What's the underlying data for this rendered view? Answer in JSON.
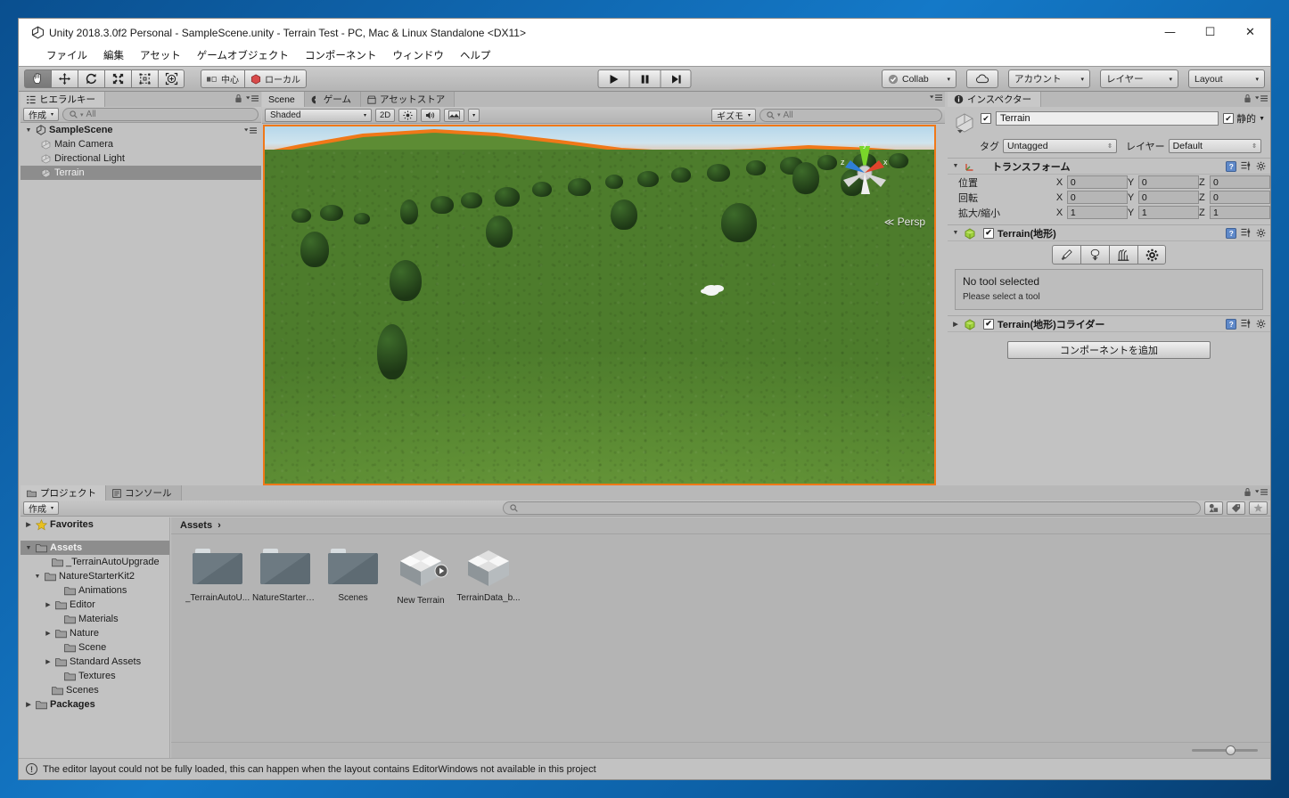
{
  "window": {
    "title": "Unity 2018.3.0f2 Personal - SampleScene.unity - Terrain Test - PC, Mac & Linux Standalone <DX11>",
    "minimize": "—",
    "maximize": "☐",
    "close": "✕"
  },
  "menu": {
    "items": [
      {
        "label": "ファイル"
      },
      {
        "label": "編集"
      },
      {
        "label": "アセット"
      },
      {
        "label": "ゲームオブジェクト"
      },
      {
        "label": "コンポーネント"
      },
      {
        "label": "ウィンドウ"
      },
      {
        "label": "ヘルプ"
      }
    ]
  },
  "toolbar": {
    "tools": [
      {
        "name": "hand-tool",
        "active": true
      },
      {
        "name": "move-tool",
        "active": false
      },
      {
        "name": "rotate-tool",
        "active": false
      },
      {
        "name": "scale-tool",
        "active": false
      },
      {
        "name": "rect-tool",
        "active": false
      },
      {
        "name": "transform-tool",
        "active": false
      }
    ],
    "pivot_label": "中心",
    "space_label": "ローカル",
    "play_label": "▶",
    "pause_label": "▐▐",
    "step_label": "▶|",
    "collab_label": "Collab",
    "cloud_label": "cloud-icon",
    "account_label": "アカウント",
    "layers_label": "レイヤー",
    "layout_label": "Layout",
    "caret": "▾"
  },
  "hierarchy": {
    "tab_label": "ヒエラルキー",
    "create_label": "作成",
    "search_placeholder": "All",
    "scene_name": "SampleScene",
    "items": [
      {
        "label": "Main Camera",
        "selected": false
      },
      {
        "label": "Directional Light",
        "selected": false
      },
      {
        "label": "Terrain",
        "selected": true
      }
    ]
  },
  "scene": {
    "tabs": [
      {
        "label": "Scene",
        "active": true
      },
      {
        "label": "ゲーム",
        "active": false
      },
      {
        "label": "アセットストア",
        "active": false
      }
    ],
    "shading_mode": "Shaded",
    "mode_2d": "2D",
    "lighting_icon": "sun-icon",
    "audio_icon": "speaker-icon",
    "effects_icon": "image-icon",
    "gizmos_label": "ギズモ",
    "search_placeholder": "All",
    "perspective_label": "Persp",
    "gizmo_axis_x": "x",
    "gizmo_axis_y": "y",
    "gizmo_axis_z": "z"
  },
  "inspector": {
    "tab_label": "インスペクター",
    "object_name": "Terrain",
    "object_enabled": true,
    "static_label": "静的",
    "static_checked": true,
    "tag_label": "タグ",
    "tag_value": "Untagged",
    "layer_label": "レイヤー",
    "layer_value": "Default",
    "transform": {
      "title": "トランスフォーム",
      "rows": [
        {
          "label": "位置",
          "x": "0",
          "y": "0",
          "z": "0"
        },
        {
          "label": "回転",
          "x": "0",
          "y": "0",
          "z": "0"
        },
        {
          "label": "拡大/縮小",
          "x": "1",
          "y": "1",
          "z": "1"
        }
      ],
      "axis_x": "X",
      "axis_y": "Y",
      "axis_z": "Z"
    },
    "terrain_component": {
      "title": "Terrain(地形)",
      "enabled": true,
      "tools": [
        {
          "name": "paint-brush-icon"
        },
        {
          "name": "paint-trees-icon"
        },
        {
          "name": "paint-details-icon"
        },
        {
          "name": "terrain-settings-icon"
        }
      ],
      "notice_title": "No tool selected",
      "notice_sub": "Please select a tool"
    },
    "collider_component": {
      "title": "Terrain(地形)コライダー",
      "enabled": true
    },
    "add_component_label": "コンポーネントを追加"
  },
  "project": {
    "tabs": [
      {
        "label": "プロジェクト",
        "active": true
      },
      {
        "label": "コンソール",
        "active": false
      }
    ],
    "create_label": "作成",
    "search_placeholder": "",
    "breadcrumb": "Assets",
    "breadcrumb_sep": "›",
    "tree": [
      {
        "label": "Favorites",
        "depth": 0,
        "arrow": "▶",
        "icon": "star-icon",
        "bold": true,
        "selected": false
      },
      {
        "label": "Assets",
        "depth": 0,
        "arrow": "▼",
        "icon": "folder-icon",
        "bold": true,
        "selected": true
      },
      {
        "label": "_TerrainAutoUpgrade",
        "depth": 1,
        "arrow": "",
        "icon": "folder-icon",
        "bold": false,
        "selected": false
      },
      {
        "label": "NatureStarterKit2",
        "depth": 1,
        "arrow": "▼",
        "icon": "folder-icon",
        "bold": false,
        "selected": false
      },
      {
        "label": "Animations",
        "depth": 2,
        "arrow": "",
        "icon": "folder-icon",
        "bold": false,
        "selected": false
      },
      {
        "label": "Editor",
        "depth": 2,
        "arrow": "▶",
        "icon": "folder-icon",
        "bold": false,
        "selected": false
      },
      {
        "label": "Materials",
        "depth": 2,
        "arrow": "",
        "icon": "folder-icon",
        "bold": false,
        "selected": false
      },
      {
        "label": "Nature",
        "depth": 2,
        "arrow": "▶",
        "icon": "folder-icon",
        "bold": false,
        "selected": false
      },
      {
        "label": "Scene",
        "depth": 2,
        "arrow": "",
        "icon": "folder-icon",
        "bold": false,
        "selected": false
      },
      {
        "label": "Standard Assets",
        "depth": 2,
        "arrow": "▶",
        "icon": "folder-icon",
        "bold": false,
        "selected": false
      },
      {
        "label": "Textures",
        "depth": 2,
        "arrow": "",
        "icon": "folder-icon",
        "bold": false,
        "selected": false
      },
      {
        "label": "Scenes",
        "depth": 1,
        "arrow": "",
        "icon": "folder-icon",
        "bold": false,
        "selected": false
      },
      {
        "label": "Packages",
        "depth": 0,
        "arrow": "▶",
        "icon": "folder-icon",
        "bold": true,
        "selected": false
      }
    ],
    "assets": [
      {
        "label": "_TerrainAutoU...",
        "type": "folder"
      },
      {
        "label": "NatureStarterK...",
        "type": "folder"
      },
      {
        "label": "Scenes",
        "type": "folder"
      },
      {
        "label": "New Terrain",
        "type": "prefab"
      },
      {
        "label": "TerrainData_b...",
        "type": "asset"
      }
    ]
  },
  "statusbar": {
    "message": "The editor layout could not be fully loaded, this can happen when the layout contains EditorWindows not available in this project",
    "icon": "warning-icon"
  },
  "colors": {
    "selection_orange": "#f07818",
    "panel_gray": "#c2c2c2",
    "selected_row": "#8d8d8d",
    "desktop_blue": "#1479c8"
  }
}
